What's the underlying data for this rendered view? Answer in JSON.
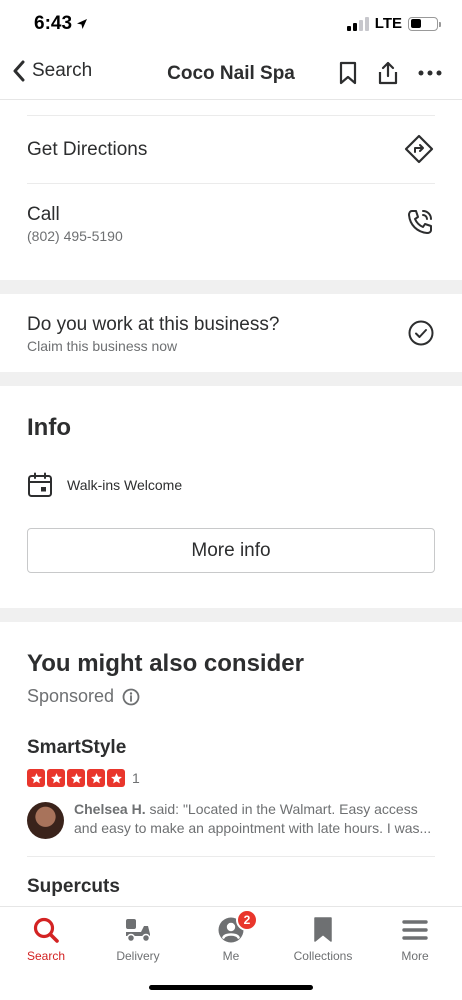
{
  "status": {
    "time": "6:43",
    "network": "LTE"
  },
  "nav": {
    "back_label": "Search",
    "title": "Coco Nail Spa"
  },
  "actions": {
    "directions_label": "Get Directions",
    "call_label": "Call",
    "call_phone": "(802) 495-5190",
    "claim_title": "Do you work at this business?",
    "claim_sub": "Claim this business now"
  },
  "info": {
    "heading": "Info",
    "walkins": "Walk-ins Welcome",
    "more_info_label": "More info"
  },
  "consider": {
    "heading": "You might also consider",
    "sponsored": "Sponsored",
    "businesses": [
      {
        "name": "SmartStyle",
        "rating": 5,
        "review_count": "1",
        "reviewer": "Chelsea H.",
        "review_prefix": " said: \"Located in the Walmart. Easy access",
        "review_line2": "and easy to make an appointment with late hours. I was..."
      },
      {
        "name": "Supercuts"
      }
    ]
  },
  "tabs": [
    {
      "label": "Search",
      "icon": "search-icon",
      "active": true
    },
    {
      "label": "Delivery",
      "icon": "delivery-icon",
      "active": false
    },
    {
      "label": "Me",
      "icon": "profile-icon",
      "active": false,
      "badge": "2"
    },
    {
      "label": "Collections",
      "icon": "bookmark-icon",
      "active": false
    },
    {
      "label": "More",
      "icon": "menu-icon",
      "active": false
    }
  ],
  "colors": {
    "accent": "#d32323",
    "star": "#e9362c",
    "text": "#2d2e2f",
    "muted": "#6e7072"
  }
}
